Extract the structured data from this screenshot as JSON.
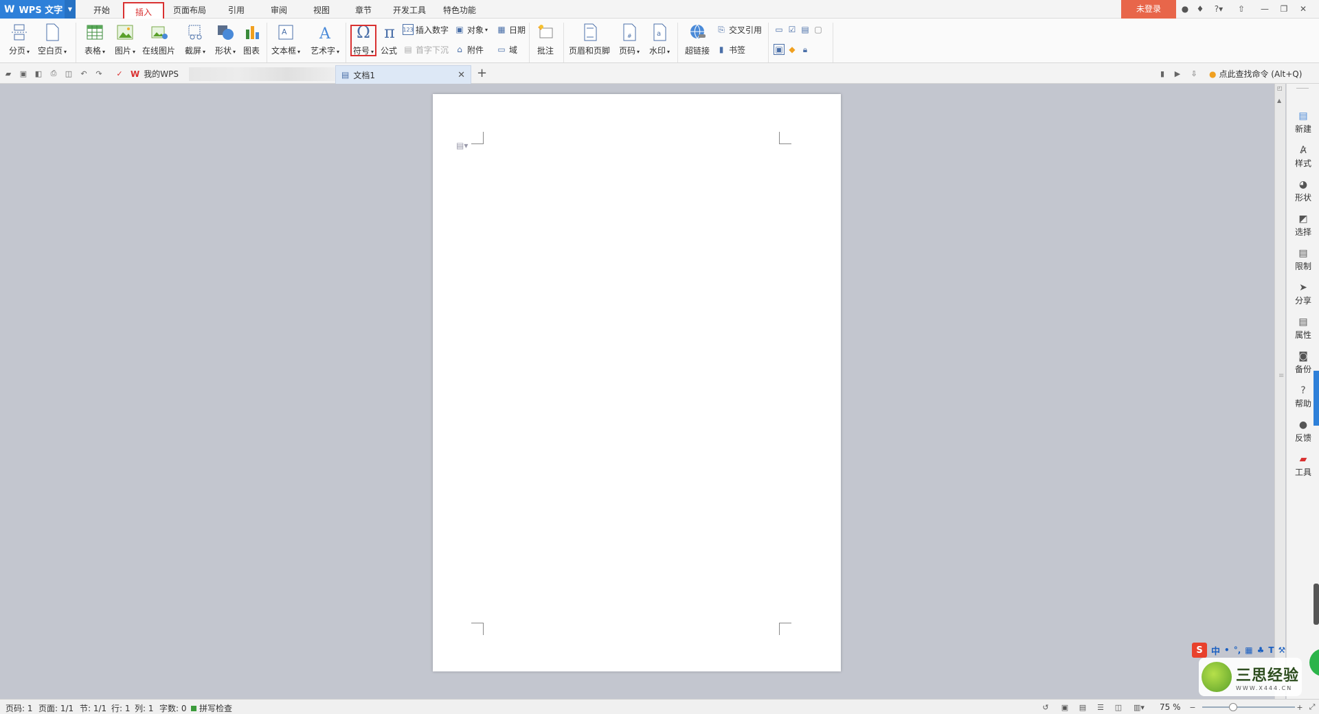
{
  "app": {
    "name": "WPS 文字"
  },
  "menu": {
    "tabs": [
      "开始",
      "插入",
      "页面布局",
      "引用",
      "审阅",
      "视图",
      "章节",
      "开发工具",
      "特色功能"
    ],
    "active": "插入"
  },
  "account": {
    "login_label": "未登录"
  },
  "ribbon": {
    "page_break": "分页",
    "blank_page": "空白页",
    "table": "表格",
    "picture": "图片",
    "online_picture": "在线图片",
    "screenshot": "截屏",
    "shape": "形状",
    "chart": "图表",
    "textbox": "文本框",
    "wordart": "艺术字",
    "symbol": "符号",
    "formula": "公式",
    "insert_number": "插入数字",
    "drop_cap": "首字下沉",
    "object": "对象",
    "attachment": "附件",
    "date": "日期",
    "field": "域",
    "comment": "批注",
    "header_footer": "页眉和页脚",
    "page_number": "页码",
    "watermark": "水印",
    "hyperlink": "超链接",
    "cross_reference": "交叉引用",
    "bookmark": "书签"
  },
  "tabbar": {
    "my_wps": "我的WPS",
    "document_tab": "文档1",
    "command_search": "点此查找命令 (Alt+Q)"
  },
  "sidebar": {
    "items": [
      "新建",
      "样式",
      "形状",
      "选择",
      "限制",
      "分享",
      "属性",
      "备份",
      "帮助",
      "反馈",
      "工具"
    ]
  },
  "status": {
    "page": "页码: 1",
    "pages": "页面: 1/1",
    "section": "节: 1/1",
    "row": "行: 1",
    "col": "列: 1",
    "words": "字数: 0",
    "spell": "拼写检查",
    "zoom": "75 %"
  },
  "overlay": {
    "ime": [
      "S",
      "中",
      "•",
      "°,",
      "▦",
      "♣",
      "T",
      "⚒"
    ],
    "watermark_title": "三思经验",
    "watermark_url": "WWW.X444.CN"
  },
  "colors": {
    "accent": "#2e80d9",
    "highlight": "#d93030",
    "login": "#e8664a"
  }
}
